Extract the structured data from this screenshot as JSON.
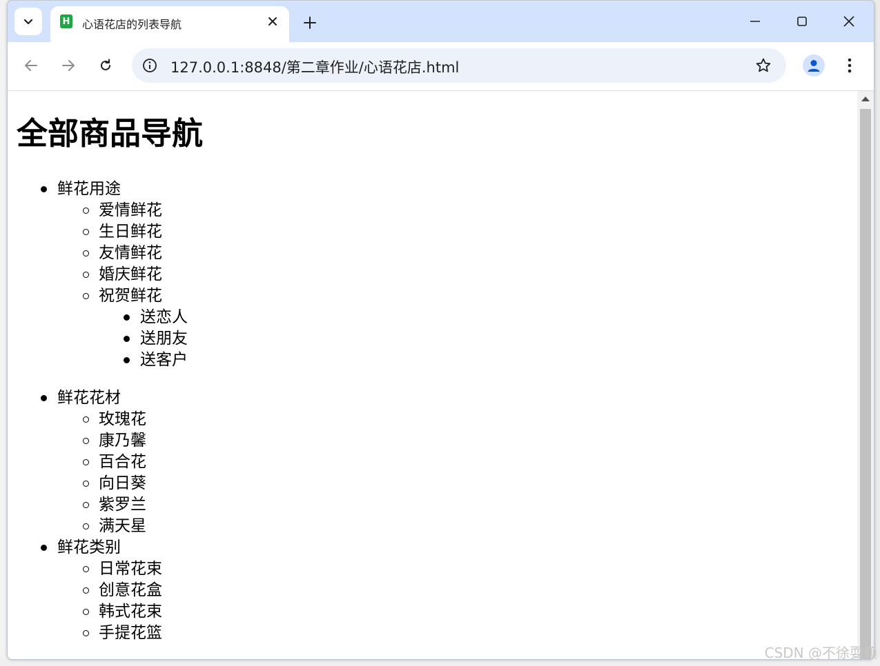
{
  "browser": {
    "tab_title": "心语花店的列表导航",
    "favicon_letter": "H",
    "url": "127.0.0.1:8848/第二章作业/心语花店.html"
  },
  "page": {
    "heading": "全部商品导航",
    "categories": [
      {
        "label": "鲜花用途",
        "items": [
          {
            "label": "爱情鲜花"
          },
          {
            "label": "生日鲜花"
          },
          {
            "label": "友情鲜花"
          },
          {
            "label": "婚庆鲜花"
          },
          {
            "label": "祝贺鲜花",
            "children": [
              "送恋人",
              "送朋友",
              "送客户"
            ]
          }
        ]
      },
      {
        "label": "鲜花花材",
        "items": [
          {
            "label": "玫瑰花"
          },
          {
            "label": "康乃馨"
          },
          {
            "label": "百合花"
          },
          {
            "label": "向日葵"
          },
          {
            "label": "紫罗兰"
          },
          {
            "label": "满天星"
          }
        ]
      },
      {
        "label": "鲜花类别",
        "items": [
          {
            "label": "日常花束"
          },
          {
            "label": "创意花盒"
          },
          {
            "label": "韩式花束"
          },
          {
            "label": "手提花篮"
          }
        ]
      }
    ]
  },
  "watermark": "CSDN @不徐耍赖",
  "icons": {
    "tab_search": "chevron-down-icon",
    "close": "close-icon",
    "new_tab": "plus-icon",
    "back": "back-arrow-icon",
    "forward": "forward-arrow-icon",
    "reload": "reload-icon",
    "site_info": "info-icon",
    "bookmark": "star-icon",
    "profile": "person-icon",
    "menu": "kebab-menu-icon"
  }
}
